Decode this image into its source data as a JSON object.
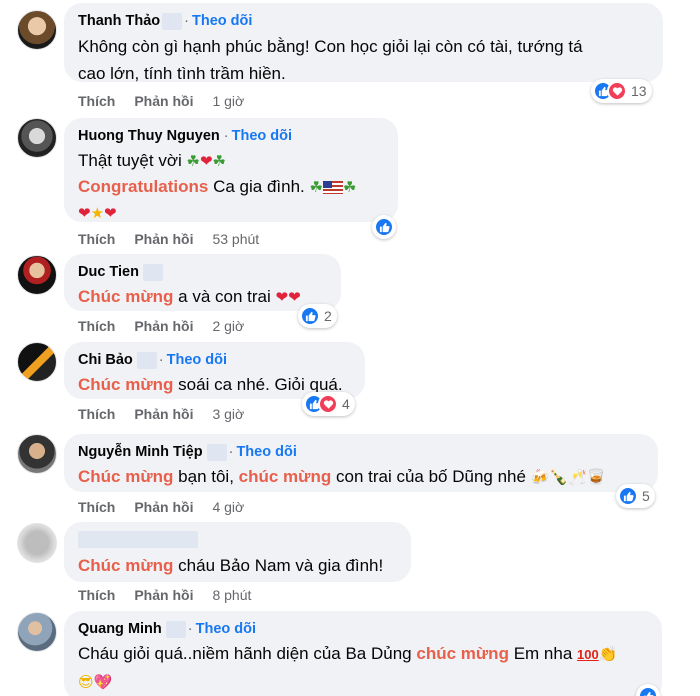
{
  "follow_label": "Theo dõi",
  "like_label": "Thích",
  "reply_label": "Phản hồi",
  "colors": {
    "highlight": "#e8604c",
    "link": "#1877f2",
    "bubble": "#f0f2f5",
    "muted": "#65676b"
  },
  "comments": [
    {
      "name": "Thanh Thảo",
      "text1": "Không còn gì hạnh phúc bằng! Con học giỏi lại còn có tài, tướng tá",
      "text2": "cao lớn, tính tình trầm hiền.",
      "time": "1 giờ",
      "reaction_count": "13"
    },
    {
      "name": "Huong Thuy Nguyen",
      "text1": "Thật tuyệt vời",
      "congrats": "Congratulations",
      "text2": "Ca gia đình.",
      "time": "53 phút"
    },
    {
      "name": "Duc Tien",
      "highlight": "Chúc mừng",
      "text": "a và con trai",
      "time": "2 giờ",
      "reaction_count": "2"
    },
    {
      "name": "Chi Bảo",
      "highlight": "Chúc mừng",
      "text": "soái ca nhé. Giỏi quá.",
      "time": "3 giờ",
      "reaction_count": "4"
    },
    {
      "name": "Nguyễn Minh Tiệp",
      "highlight": "Chúc mừng",
      "text_a": "bạn tôi,",
      "highlight2": "chúc mừng",
      "text_b": "con trai của bố Dũng nhé",
      "time": "4 giờ",
      "reaction_count": "5"
    },
    {
      "name": "",
      "highlight": "Chúc mừng",
      "text": "cháu Bảo Nam và gia đình!",
      "time": "8 phút"
    },
    {
      "name": "Quang Minh",
      "text_a": "Cháu giỏi quá..niềm hãnh diện của Ba Dủng",
      "highlight": "chúc mừng",
      "text_b": "Em nha"
    }
  ]
}
